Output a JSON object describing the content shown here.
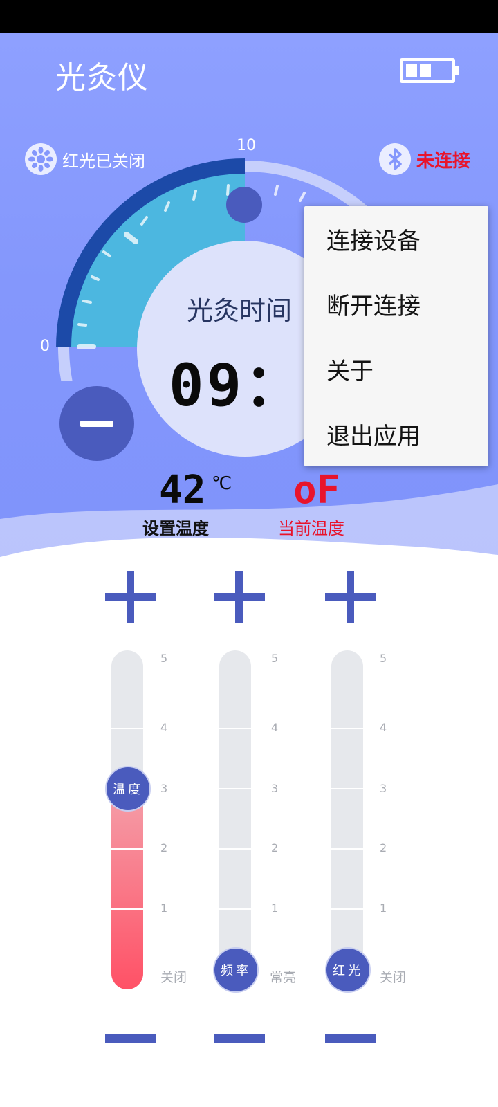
{
  "app": {
    "title": "光灸仪",
    "battery_icon": "battery-icon"
  },
  "status": {
    "red_light": "红光已关闭",
    "bluetooth": "未连接",
    "bluetooth_color": "#e8142c"
  },
  "dial": {
    "min_label": "0",
    "max_label": "10",
    "label": "光灸时间",
    "time": "09：09"
  },
  "menu": {
    "items": [
      {
        "label": "连接设备"
      },
      {
        "label": "断开连接"
      },
      {
        "label": "关于"
      },
      {
        "label": "退出应用"
      }
    ]
  },
  "temperature": {
    "set_value": "42",
    "unit": "℃",
    "set_label": "设置温度",
    "current_value": "oF",
    "current_label": "当前温度",
    "current_color": "#e8142c"
  },
  "sliders": [
    {
      "knob_label": "温度",
      "end_label": "关闭",
      "level": 3,
      "ticks": [
        "5",
        "4",
        "3",
        "2",
        "1"
      ]
    },
    {
      "knob_label": "频率",
      "end_label": "常亮",
      "level": 0,
      "ticks": [
        "5",
        "4",
        "3",
        "2",
        "1"
      ]
    },
    {
      "knob_label": "红光",
      "end_label": "关闭",
      "level": 0,
      "ticks": [
        "5",
        "4",
        "3",
        "2",
        "1"
      ]
    }
  ],
  "colors": {
    "accent": "#4a5bbd",
    "header": "#8497fc",
    "warm": "#ff5166"
  }
}
